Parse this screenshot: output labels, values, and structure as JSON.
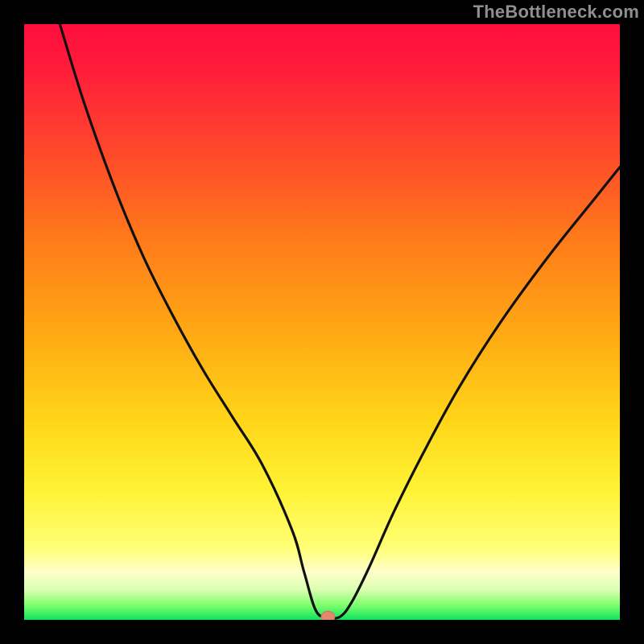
{
  "watermark": "TheBottleneck.com",
  "chart_data": {
    "type": "line",
    "title": "",
    "xlabel": "",
    "ylabel": "",
    "xlim": [
      0,
      100
    ],
    "ylim": [
      0,
      100
    ],
    "grid": false,
    "legend": false,
    "marker": {
      "x": 51,
      "y": 0.5,
      "color": "#e2886f"
    },
    "series": [
      {
        "name": "bottleneck-curve",
        "x": [
          6,
          10,
          15,
          20,
          25,
          30,
          35,
          40,
          45,
          47,
          49,
          51,
          53,
          55,
          58,
          62,
          67,
          73,
          80,
          88,
          96,
          100
        ],
        "y": [
          100,
          87,
          73,
          61,
          51,
          42,
          34,
          26,
          15,
          8,
          1.5,
          0.5,
          0.5,
          3,
          9,
          18,
          28,
          39,
          50,
          61,
          71,
          76
        ]
      }
    ],
    "background_gradient": {
      "direction": "vertical",
      "stops": [
        {
          "pos": 0.0,
          "color": "#ff0c3e"
        },
        {
          "pos": 0.22,
          "color": "#ff4a2a"
        },
        {
          "pos": 0.52,
          "color": "#ffa914"
        },
        {
          "pos": 0.78,
          "color": "#fff233"
        },
        {
          "pos": 0.92,
          "color": "#ffffcc"
        },
        {
          "pos": 0.975,
          "color": "#7fff6e"
        },
        {
          "pos": 1.0,
          "color": "#11e35b"
        }
      ]
    }
  }
}
